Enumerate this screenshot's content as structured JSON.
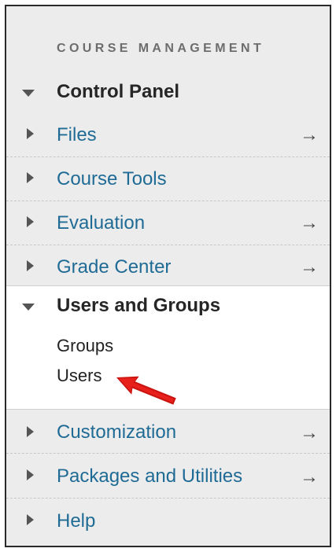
{
  "panel": {
    "section_title": "COURSE MANAGEMENT",
    "arrow_glyph": "→"
  },
  "menu": {
    "control_panel": {
      "label": "Control Panel"
    },
    "items_top": [
      {
        "label": "Files",
        "has_arrow": true
      },
      {
        "label": "Course Tools",
        "has_arrow": false
      },
      {
        "label": "Evaluation",
        "has_arrow": true
      },
      {
        "label": "Grade Center",
        "has_arrow": true
      }
    ],
    "users_and_groups": {
      "label": "Users and Groups",
      "children": [
        "Groups",
        "Users"
      ]
    },
    "items_bottom": [
      {
        "label": "Customization",
        "has_arrow": true
      },
      {
        "label": "Packages and Utilities",
        "has_arrow": true
      },
      {
        "label": "Help",
        "has_arrow": false
      }
    ]
  },
  "colors": {
    "link": "#1f6b95",
    "annotation_arrow": "#e8201c",
    "panel_bg": "#ececec"
  }
}
